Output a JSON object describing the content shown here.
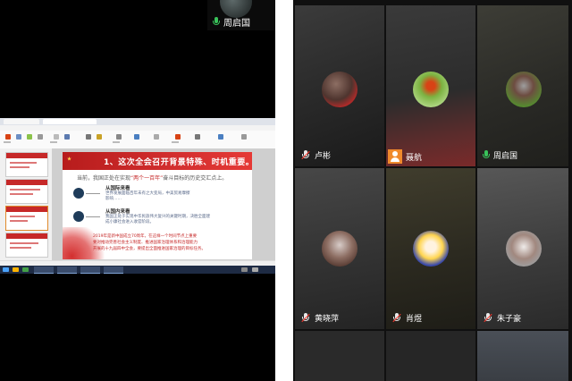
{
  "self_preview": {
    "name": "周启国",
    "mic": "active"
  },
  "shared_slide": {
    "title": "1、这次全会召开背景特殊、时机重要。",
    "intro_prefix": "当前，我国正处在实现",
    "intro_highlight": "“两个一百年”",
    "intro_suffix": "奋斗目标的历史交汇点上。",
    "points": [
      {
        "heading": "从国际来看",
        "lines": [
          "世界发展面临百年未有之大变局，中美贸易摩擦",
          "影响……"
        ]
      },
      {
        "heading": "从国内来看",
        "lines": [
          "我国正处于实现中华民族伟大复兴的关键时期，决胜全面建",
          "成小康社会进入收官阶段。"
        ]
      }
    ],
    "footer_lines": [
      "2019年是新中国成立70周年，在这样一个时间节点上重要",
      "要对推动完善社会主义制度、推进国家治理体系和治理能力",
      "开展的十九届四中全会，要提出全面推进国家治理的目标任务。"
    ]
  },
  "participants": [
    {
      "name": "卢彬",
      "mic": "muted",
      "active": false,
      "colors": {
        "bg1": "#3a3a3a",
        "bg2": "#1c1c1c"
      }
    },
    {
      "name": "聂航",
      "mic": "host",
      "active": false,
      "colors": {
        "bg1": "#5a2a2a",
        "bg2": "#2a1e1e"
      }
    },
    {
      "name": "周启国",
      "mic": "active",
      "active": true,
      "colors": {
        "bg1": "#3b3b33",
        "bg2": "#24241f"
      }
    },
    {
      "name": "黄晓萍",
      "mic": "muted",
      "active": false,
      "colors": {
        "bg1": "#444",
        "bg2": "#2a2a2a"
      }
    },
    {
      "name": "肖煜",
      "mic": "muted",
      "active": false,
      "colors": {
        "bg1": "#3d3a2a",
        "bg2": "#25231b"
      }
    },
    {
      "name": "朱子豪",
      "mic": "muted",
      "active": false,
      "colors": {
        "bg1": "#555",
        "bg2": "#333"
      }
    }
  ],
  "colors": {
    "active_border": "#4fd66a",
    "host_badge": "#f08a2c",
    "mic_active": "#39c35a"
  }
}
